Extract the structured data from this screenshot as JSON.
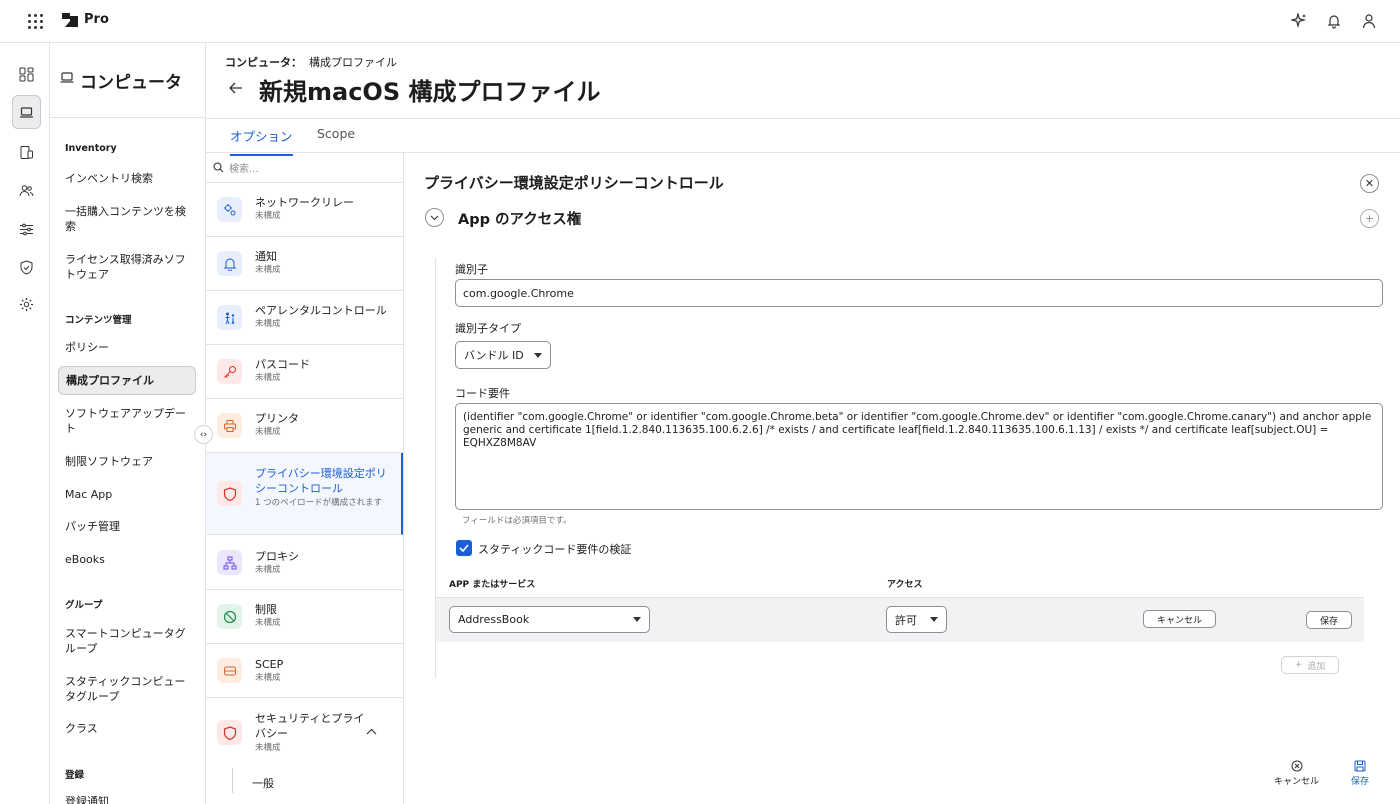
{
  "topbar": {
    "brand": "Pro"
  },
  "nav": {
    "title": "コンピュータ",
    "sections": [
      {
        "label": "Inventory"
      },
      {
        "label": "コンテンツ管理"
      },
      {
        "label": "グループ"
      },
      {
        "label": "登録"
      }
    ],
    "items": [
      {
        "label": "インベントリ検索"
      },
      {
        "label": "一括購入コンテンツを検索"
      },
      {
        "label": "ライセンス取得済みソフトウェア"
      },
      {
        "label": "ポリシー"
      },
      {
        "label": "構成プロファイル"
      },
      {
        "label": "ソフトウェアアップデート"
      },
      {
        "label": "制限ソフトウェア"
      },
      {
        "label": "Mac App"
      },
      {
        "label": "パッチ管理"
      },
      {
        "label": "eBooks"
      },
      {
        "label": "スマートコンピュータグループ"
      },
      {
        "label": "スタティックコンピュータグループ"
      },
      {
        "label": "クラス"
      },
      {
        "label": "登録通知"
      }
    ]
  },
  "header": {
    "breadcrumb_parent": "コンピュータ：",
    "breadcrumb_current": "構成プロファイル",
    "title": "新規macOS 構成プロファイル"
  },
  "tabs": [
    {
      "label": "オプション",
      "active": true
    },
    {
      "label": "Scope",
      "active": false
    }
  ],
  "payloads": {
    "search_placeholder": "検索...",
    "items": [
      {
        "name": "ネットワークリレー",
        "status": "未構成",
        "icon": "network-relay-icon",
        "color": "#e8eefc"
      },
      {
        "name": "通知",
        "status": "未構成",
        "icon": "bell-icon",
        "color": "#e8eefc"
      },
      {
        "name": "ペアレンタルコントロール",
        "status": "未構成",
        "icon": "family-icon",
        "color": "#e8eefc"
      },
      {
        "name": "パスコード",
        "status": "未構成",
        "icon": "key-icon",
        "color": "#fde8e8"
      },
      {
        "name": "プリンタ",
        "status": "未構成",
        "icon": "printer-icon",
        "color": "#fdecdf"
      },
      {
        "name": "プライバシー環境設定ポリシーコントロール",
        "status": "1 つのペイロードが構成されます",
        "icon": "shield-icon",
        "color": "#fde8e8"
      },
      {
        "name": "プロキシ",
        "status": "未構成",
        "icon": "proxy-icon",
        "color": "#ebe6fb"
      },
      {
        "name": "制限",
        "status": "未構成",
        "icon": "restriction-icon",
        "color": "#e3f5ea"
      },
      {
        "name": "SCEP",
        "status": "未構成",
        "icon": "scep-icon",
        "color": "#fdecdf"
      },
      {
        "name": "セキュリティとプライバシー",
        "status": "未構成",
        "icon": "security-shield-icon",
        "color": "#fde8e8"
      }
    ],
    "sub_item": "一般"
  },
  "form": {
    "title": "プライバシー環境設定ポリシーコントロール",
    "section_title": "App のアクセス権",
    "identifier_label": "識別子",
    "identifier_value": "com.google.Chrome",
    "identifier_type_label": "識別子タイプ",
    "identifier_type_value": "バンドル ID",
    "code_req_label": "コード要件",
    "code_req_value": "(identifier \"com.google.Chrome\" or identifier \"com.google.Chrome.beta\" or identifier \"com.google.Chrome.dev\" or identifier \"com.google.Chrome.canary\") and anchor apple generic and certificate 1[field.1.2.840.113635.100.6.2.6] /* exists / and certificate leaf[field.1.2.840.113635.100.6.1.13] / exists */ and certificate leaf[subject.OU] = EQHXZ8M8AV",
    "required_hint": "フィールドは必須項目です。",
    "static_check_label": "スタティックコード要件の検証",
    "static_check_checked": true,
    "table": {
      "col_app": "APP またはサービス",
      "col_access": "アクセス",
      "row_app": "AddressBook",
      "row_access": "許可",
      "cancel_label": "キャンセル",
      "save_label": "保存"
    },
    "add_label": "追加"
  },
  "footer": {
    "cancel_label": "キャンセル",
    "save_label": "保存"
  },
  "colors": {
    "accent": "#1a5fd8"
  }
}
